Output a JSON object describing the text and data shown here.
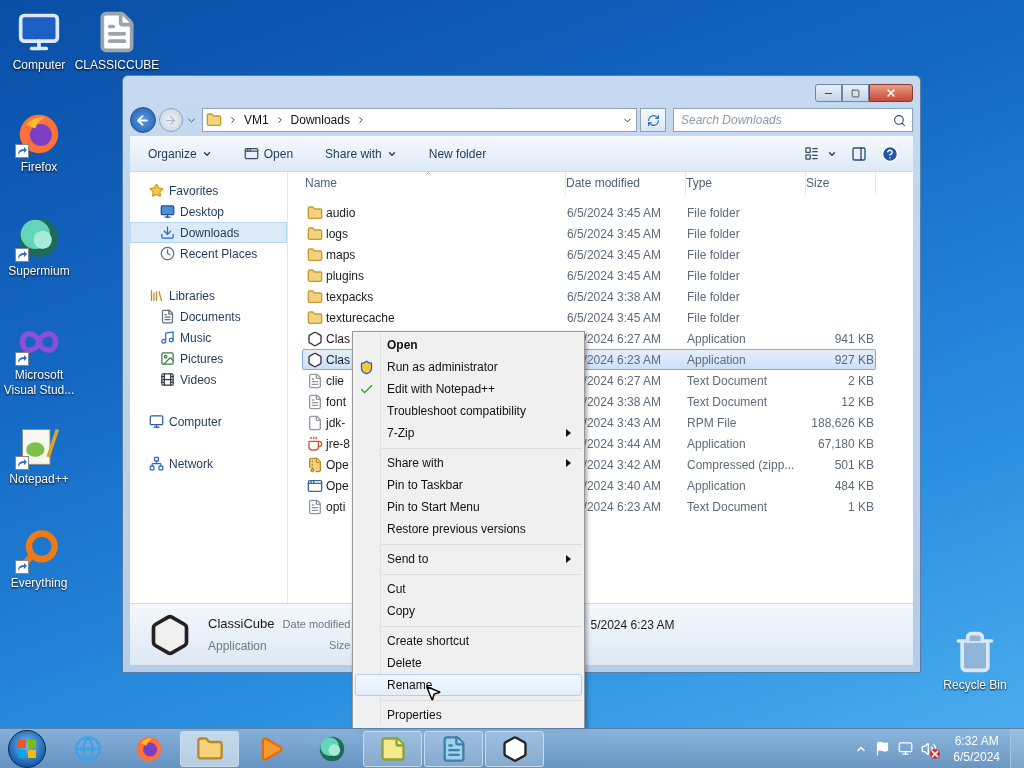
{
  "desktop": {
    "icons": [
      {
        "label": "Computer",
        "kind": "computer",
        "shortcut": false
      },
      {
        "label": "CLASSICCUBE",
        "kind": "document",
        "shortcut": false
      },
      {
        "label": "Firefox",
        "kind": "firefox",
        "shortcut": true
      },
      {
        "label": "Supermium",
        "kind": "supermium",
        "shortcut": true
      },
      {
        "label": "Microsoft Visual Stud...",
        "kind": "vs",
        "shortcut": true
      },
      {
        "label": "Notepad++",
        "kind": "notepad",
        "shortcut": true
      },
      {
        "label": "Everything",
        "kind": "everything",
        "shortcut": true
      },
      {
        "label": "Recycle Bin",
        "kind": "recycle",
        "shortcut": false
      }
    ]
  },
  "window": {
    "address": {
      "crumbs": [
        "VM1",
        "Downloads"
      ],
      "search_placeholder": "Search Downloads"
    },
    "toolbar": [
      {
        "label": "Organize",
        "kind": "menu"
      },
      {
        "label": "Open",
        "kind": "icon"
      },
      {
        "label": "Share with",
        "kind": "menu"
      },
      {
        "label": "New folder",
        "kind": "plain"
      }
    ],
    "nav": [
      {
        "label": "Favorites",
        "kind": "star",
        "selected": false,
        "children": [
          {
            "label": "Desktop",
            "kind": "desktop",
            "selected": false
          },
          {
            "label": "Downloads",
            "kind": "downloads",
            "selected": true
          },
          {
            "label": "Recent Places",
            "kind": "recent",
            "selected": false
          }
        ]
      },
      {
        "label": "Libraries",
        "kind": "libraries",
        "selected": false,
        "children": [
          {
            "label": "Documents",
            "kind": "documents",
            "selected": false
          },
          {
            "label": "Music",
            "kind": "music",
            "selected": false
          },
          {
            "label": "Pictures",
            "kind": "pictures",
            "selected": false
          },
          {
            "label": "Videos",
            "kind": "videos",
            "selected": false
          }
        ]
      },
      {
        "label": "Computer",
        "kind": "computer",
        "selected": false
      },
      {
        "label": "Network",
        "kind": "network",
        "selected": false
      }
    ],
    "columns": [
      {
        "label": "Name",
        "sorted": true
      },
      {
        "label": "Date modified",
        "sorted": false
      },
      {
        "label": "Type",
        "sorted": false
      },
      {
        "label": "Size",
        "sorted": false
      }
    ],
    "rows": [
      {
        "name": "audio",
        "date": "6/5/2024 3:45 AM",
        "type": "File folder",
        "kind": "folder",
        "selected": false
      },
      {
        "name": "logs",
        "date": "6/5/2024 3:45 AM",
        "type": "File folder",
        "kind": "folder",
        "selected": false
      },
      {
        "name": "maps",
        "date": "6/5/2024 3:45 AM",
        "type": "File folder",
        "kind": "folder",
        "selected": false
      },
      {
        "name": "plugins",
        "date": "6/5/2024 3:45 AM",
        "type": "File folder",
        "kind": "folder",
        "selected": false
      },
      {
        "name": "texpacks",
        "date": "6/5/2024 3:38 AM",
        "type": "File folder",
        "kind": "folder",
        "selected": false
      },
      {
        "name": "texturecache",
        "date": "6/5/2024 3:45 AM",
        "type": "File folder",
        "kind": "folder",
        "selected": false
      },
      {
        "name": "Clas",
        "date": "/2024 6:27 AM",
        "type": "Application",
        "size": "941 KB",
        "kind": "app",
        "selected": false
      },
      {
        "name": "Clas",
        "date": "/2024 6:23 AM",
        "type": "Application",
        "size": "927 KB",
        "kind": "app",
        "selected": true
      },
      {
        "name": "clie",
        "date": "/2024 6:27 AM",
        "type": "Text Document",
        "size": "2 KB",
        "kind": "text",
        "selected": false
      },
      {
        "name": "font",
        "date": "/2024 3:38 AM",
        "type": "Text Document",
        "size": "12 KB",
        "kind": "text",
        "selected": false
      },
      {
        "name": "jdk-",
        "date": "/2024 3:43 AM",
        "type": "RPM File",
        "size": "188,626 KB",
        "kind": "file",
        "selected": false
      },
      {
        "name": "jre-8",
        "date": "/2024 3:44 AM",
        "type": "Application",
        "size": "67,180 KB",
        "kind": "java",
        "selected": false
      },
      {
        "name": "Ope",
        "date": "/2024 3:42 AM",
        "type": "Compressed (zipp...",
        "size": "501 KB",
        "kind": "zip",
        "selected": false
      },
      {
        "name": "Ope",
        "date": "/2024 3:40 AM",
        "type": "Application",
        "size": "484 KB",
        "kind": "window",
        "selected": false
      },
      {
        "name": "opti",
        "date": "/2024 6:23 AM",
        "type": "Text Document",
        "size": "1 KB",
        "kind": "text",
        "selected": false
      }
    ],
    "details": {
      "name": "ClassiCube",
      "type": "Application",
      "labels": [
        "Date modified",
        "Size"
      ],
      "date_value": "5/2024 6:23 AM"
    }
  },
  "context_menu": [
    {
      "kind": "item",
      "label": "Open",
      "default": true,
      "submenu": false,
      "selected": false
    },
    {
      "kind": "admin_item",
      "label": "Run as administrator",
      "default": false,
      "submenu": false,
      "selected": false
    },
    {
      "kind": "editor_item",
      "label": "Edit with Notepad++",
      "default": false,
      "submenu": false,
      "selected": false
    },
    {
      "kind": "item",
      "label": "Troubleshoot compatibility",
      "default": false,
      "submenu": false,
      "selected": false
    },
    {
      "kind": "item",
      "label": "7-Zip",
      "default": false,
      "submenu": true,
      "selected": false
    },
    {
      "kind": "separator"
    },
    {
      "kind": "item",
      "label": "Share with",
      "default": false,
      "submenu": true,
      "selected": false
    },
    {
      "kind": "item",
      "label": "Pin to Taskbar",
      "default": false,
      "submenu": false,
      "selected": false
    },
    {
      "kind": "item",
      "label": "Pin to Start Menu",
      "default": false,
      "submenu": false,
      "selected": false
    },
    {
      "kind": "item",
      "label": "Restore previous versions",
      "default": false,
      "submenu": false,
      "selected": false
    },
    {
      "kind": "separator"
    },
    {
      "kind": "item",
      "label": "Send to",
      "default": false,
      "submenu": true,
      "selected": false
    },
    {
      "kind": "separator"
    },
    {
      "kind": "item",
      "label": "Cut",
      "default": false,
      "submenu": false,
      "selected": false
    },
    {
      "kind": "item",
      "label": "Copy",
      "default": false,
      "submenu": false,
      "selected": false
    },
    {
      "kind": "separator"
    },
    {
      "kind": "item",
      "label": "Create shortcut",
      "default": false,
      "submenu": false,
      "selected": false
    },
    {
      "kind": "item",
      "label": "Delete",
      "default": false,
      "submenu": false,
      "selected": false
    },
    {
      "kind": "item",
      "label": "Rename",
      "default": false,
      "submenu": false,
      "selected": true
    },
    {
      "kind": "separator"
    },
    {
      "kind": "item",
      "label": "Properties",
      "default": false,
      "submenu": false,
      "selected": false
    }
  ],
  "taskbar": {
    "apps": [
      {
        "kind": "globe",
        "running": false,
        "selected": false
      },
      {
        "kind": "firefox",
        "running": false,
        "selected": false
      },
      {
        "kind": "folder",
        "running": true,
        "selected": true
      },
      {
        "kind": "player",
        "running": false,
        "selected": false
      },
      {
        "kind": "supermium",
        "running": false,
        "selected": false
      },
      {
        "kind": "notes",
        "running": true,
        "selected": false
      },
      {
        "kind": "pad",
        "running": true,
        "selected": false
      },
      {
        "kind": "cube",
        "running": true,
        "selected": false
      }
    ],
    "volume_muted": true,
    "time": "6:32 AM",
    "date": "6/5/2024"
  }
}
